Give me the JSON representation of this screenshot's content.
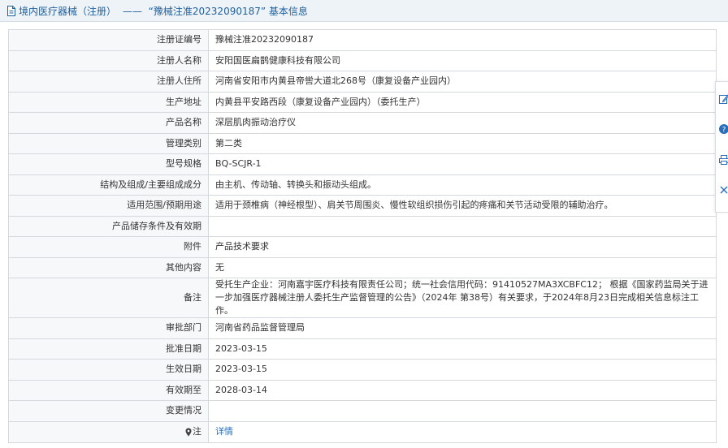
{
  "header": {
    "category": "境内医疗器械（注册）",
    "separator": "——",
    "subject": "“豫械注准20232090187”",
    "suffix": "基本信息"
  },
  "rows": [
    {
      "label": "注册证编号",
      "value": "豫械注准20232090187"
    },
    {
      "label": "注册人名称",
      "value": "安阳国医扁鹊健康科技有限公司"
    },
    {
      "label": "注册人住所",
      "value": "河南省安阳市内黄县帝喾大道北268号（康复设备产业园内）"
    },
    {
      "label": "生产地址",
      "value": "内黄县平安路西段（康复设备产业园内）（委托生产）"
    },
    {
      "label": "产品名称",
      "value": "深层肌肉振动治疗仪"
    },
    {
      "label": "管理类别",
      "value": "第二类"
    },
    {
      "label": "型号规格",
      "value": "BQ-SCJR-1"
    },
    {
      "label": "结构及组成/主要组成成分",
      "value": "由主机、传动轴、转换头和振动头组成。"
    },
    {
      "label": "适用范围/预期用途",
      "value": "适用于颈椎病（神经根型）、肩关节周围炎、慢性软组织损伤引起的疼痛和关节活动受限的辅助治疗。"
    },
    {
      "label": "产品储存条件及有效期",
      "value": ""
    },
    {
      "label": "附件",
      "value": "产品技术要求"
    },
    {
      "label": "其他内容",
      "value": "无"
    },
    {
      "label": "备注",
      "value": "受托生产企业：河南嘉宇医疗科技有限责任公司；统一社会信用代码：91410527MA3XCBFC12； 根据《国家药监局关于进一步加强医疗器械注册人委托生产监督管理的公告》（2024年 第38号）有关要求，于2024年8月23日完成相关信息标注工作。"
    },
    {
      "label": "审批部门",
      "value": "河南省药品监督管理局"
    },
    {
      "label": "批准日期",
      "value": "2023-03-15"
    },
    {
      "label": "生效日期",
      "value": "2023-03-15"
    },
    {
      "label": "有效期至",
      "value": "2028-03-14"
    },
    {
      "label": "变更情况",
      "value": ""
    }
  ],
  "note": {
    "label": "注",
    "link_text": "详情"
  },
  "sidebar": {
    "icons": [
      "edit-icon",
      "help-icon",
      "print-icon",
      "close-icon"
    ]
  },
  "colors": {
    "header_bg": "#eef3f8",
    "header_text": "#1f5f9a",
    "label_bg": "#f7f8fa",
    "border": "#d5d9de",
    "link": "#2a6ebb"
  }
}
